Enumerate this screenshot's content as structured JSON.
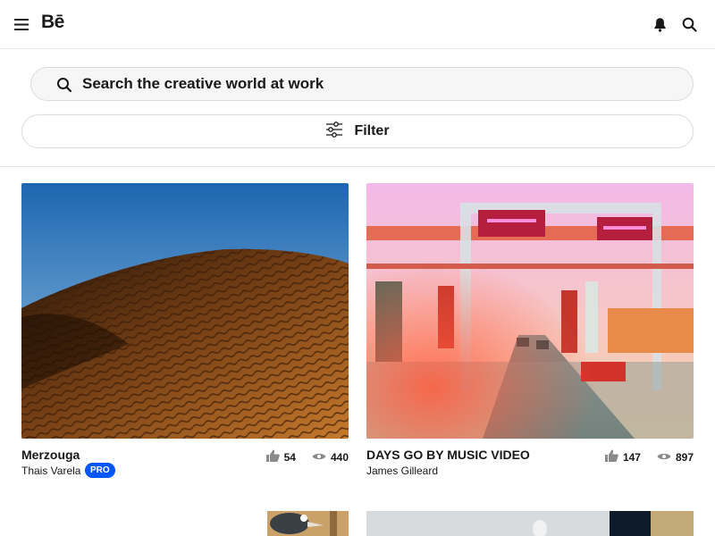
{
  "header": {
    "logo_text": "Bē",
    "menu_icon": "hamburger-icon",
    "bell_icon": "bell-icon",
    "search_icon": "search-icon"
  },
  "search": {
    "placeholder": "Search the creative world at work"
  },
  "filter": {
    "label": "Filter",
    "icon": "sliders-icon"
  },
  "projects": [
    {
      "title": "Merzouga",
      "owner": "Thais Varela",
      "badge": "PRO",
      "likes": "54",
      "views": "440",
      "image": "desert-dune-photo"
    },
    {
      "title": "DAYS GO BY MUSIC VIDEO",
      "owner": "James Gilleard",
      "badge": "",
      "likes": "147",
      "views": "897",
      "image": "highway-tollgate-illustration"
    }
  ],
  "colors": {
    "accent": "#0057ff",
    "text": "#191919",
    "border": "#dcdcdc"
  }
}
